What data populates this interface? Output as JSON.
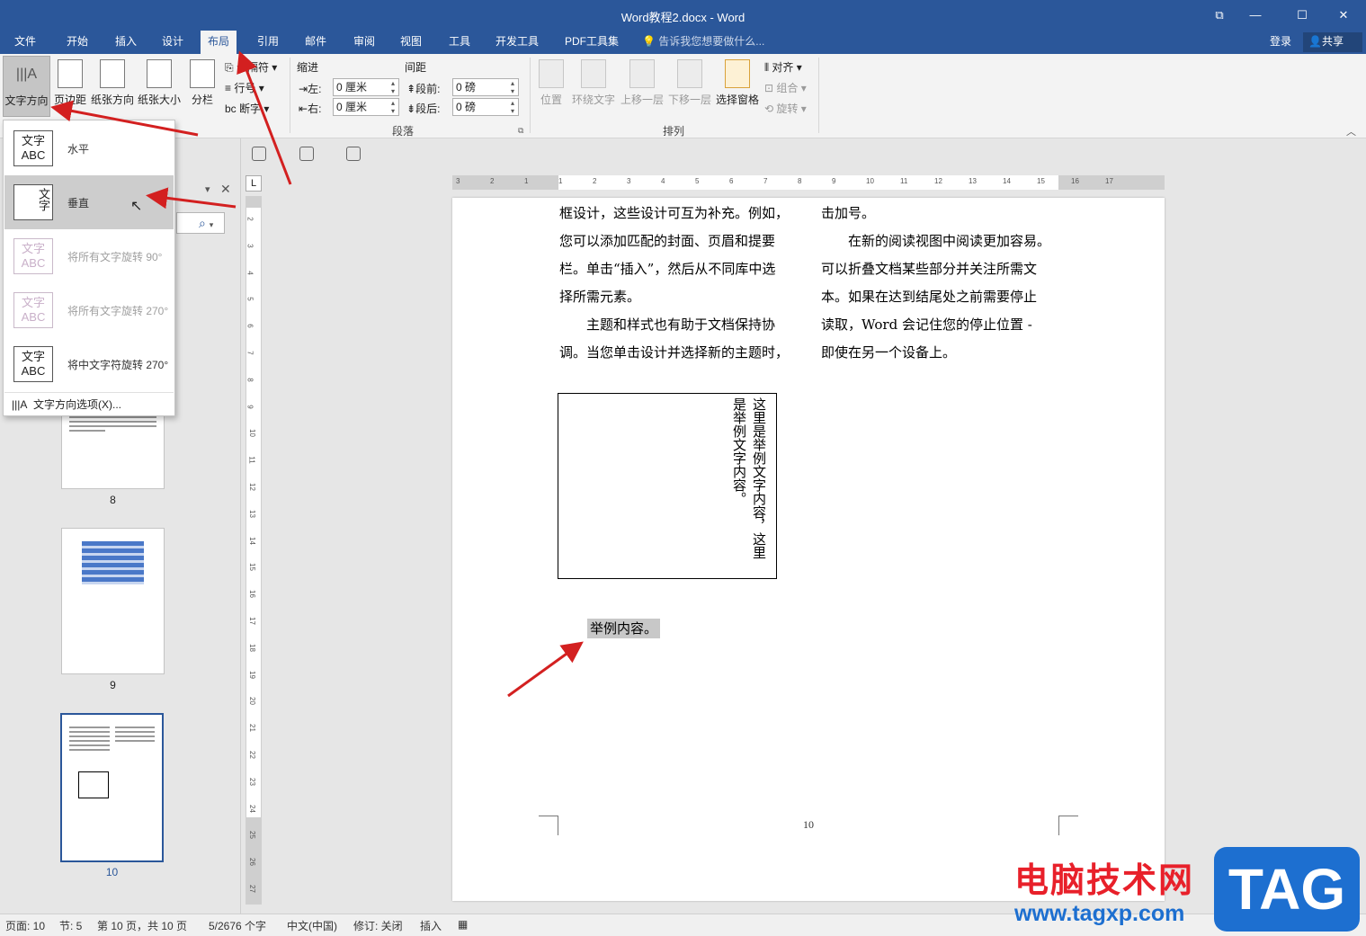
{
  "window": {
    "title": "Word教程2.docx - Word",
    "controls": [
      "⧉",
      "—",
      "☐",
      "✕"
    ]
  },
  "menu_tabs": [
    "文件",
    "开始",
    "插入",
    "设计",
    "布局",
    "引用",
    "邮件",
    "审阅",
    "视图",
    "工具",
    "开发工具",
    "PDF工具集"
  ],
  "active_tab": "布局",
  "tell_me": "告诉我您想要做什么...",
  "login": "登录",
  "share": "共享",
  "ribbon": {
    "page_setup": {
      "text_direction": "文字方向",
      "margins": "页边距",
      "orientation": "纸张方向",
      "size": "纸张大小",
      "columns": "分栏",
      "breaks": "分隔符",
      "line_numbers": "行号",
      "hyphenation": "断字"
    },
    "indent": {
      "label": "缩进",
      "left_label": "左:",
      "left_value": "0 厘米",
      "right_label": "右:",
      "right_value": "0 厘米"
    },
    "spacing": {
      "label": "间距",
      "before_label": "段前:",
      "before_value": "0 磅",
      "after_label": "段后:",
      "after_value": "0 磅"
    },
    "paragraph_group": "段落",
    "arrange": {
      "position": "位置",
      "wrap_text": "环绕文字",
      "bring_forward": "上移一层",
      "send_backward": "下移一层",
      "selection_pane": "选择窗格",
      "align": "对齐",
      "group": "组合",
      "rotate": "旋转",
      "group_label": "排列"
    }
  },
  "dropdown": {
    "items": [
      {
        "label": "水平",
        "icon_text": "文字ABC"
      },
      {
        "label": "垂直",
        "icon_text": "文字"
      },
      {
        "label": "将所有文字旋转 90°",
        "icon_text": "文字ABC"
      },
      {
        "label": "将所有文字旋转 270°",
        "icon_text": "文字ABC"
      },
      {
        "label": "将中文字符旋转 270°",
        "icon_text": "文字ABC"
      }
    ],
    "options": "文字方向选项(X)..."
  },
  "nav": {
    "pages": [
      "8",
      "9",
      "10"
    ]
  },
  "ruler": {
    "h_ticks": [
      "3",
      "2",
      "1",
      "1",
      "2",
      "3",
      "4",
      "5",
      "6",
      "7",
      "8",
      "9",
      "10",
      "11",
      "12",
      "13",
      "14",
      "15",
      "16",
      "17"
    ],
    "v_ticks": [
      "2",
      "3",
      "4",
      "5",
      "6",
      "7",
      "8",
      "9",
      "10",
      "11",
      "12",
      "13",
      "14",
      "15",
      "16",
      "17",
      "18",
      "19",
      "20",
      "21",
      "22",
      "23",
      "24",
      "25",
      "26",
      "27"
    ],
    "corner": "L"
  },
  "document": {
    "col1": [
      "框设计，这些设计可互为补充。例如，",
      "您可以添加匹配的封面、页眉和提要",
      "栏。单击“插入”，然后从不同库中选",
      "择所需元素。",
      "　　主题和样式也有助于文档保持协",
      "调。当您单击设计并选择新的主题时，"
    ],
    "col2": [
      "击加号。",
      "　　在新的阅读视图中阅读更加容易。",
      "可以折叠文档某些部分并关注所需文",
      "本。如果在达到结尾处之前需要停止",
      "读取，Word 会记住您的停止位置 -",
      "即使在另一个设备上。"
    ],
    "textbox_col1": "这里是举例文字内容，这里",
    "textbox_col2": "是举例文字内容。",
    "selected_text": "举例内容。",
    "page_number": "10"
  },
  "status": {
    "page": "页面: 10",
    "section": "节: 5",
    "page_of": "第 10 页，共 10 页",
    "words": "5/2676 个字",
    "language": "中文(中国)",
    "track": "修订: 关闭",
    "insert": "插入"
  },
  "watermark": {
    "site_name": "电脑技术网",
    "url": "www.tagxp.com",
    "tag": "TAG"
  },
  "colors": {
    "accent": "#2b579a",
    "arrow": "#d32020",
    "watermark_red": "#e8202a",
    "watermark_blue": "#1d6fd0"
  }
}
